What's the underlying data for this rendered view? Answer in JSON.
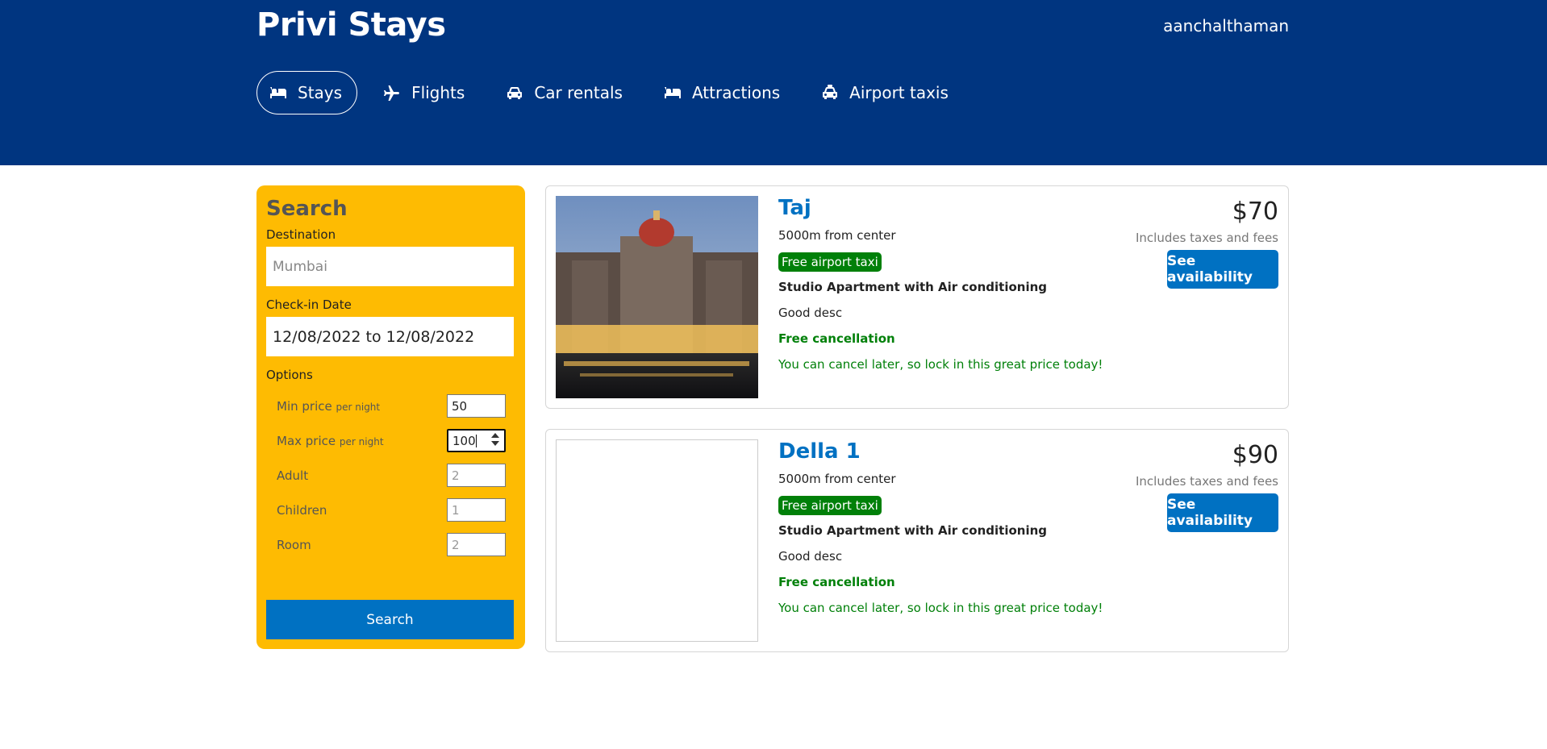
{
  "header": {
    "logo": "Privi Stays",
    "username": "aanchalthaman"
  },
  "nav": {
    "items": [
      {
        "label": "Stays",
        "icon": "bed-icon",
        "active": true
      },
      {
        "label": "Flights",
        "icon": "plane-icon",
        "active": false
      },
      {
        "label": "Car rentals",
        "icon": "car-icon",
        "active": false
      },
      {
        "label": "Attractions",
        "icon": "bed-icon",
        "active": false
      },
      {
        "label": "Airport taxis",
        "icon": "taxi-icon",
        "active": false
      }
    ]
  },
  "search": {
    "title": "Search",
    "destination_label": "Destination",
    "destination_placeholder": "Mumbai",
    "checkin_label": "Check-in Date",
    "checkin_value": "12/08/2022 to 12/08/2022",
    "options_label": "Options",
    "options": [
      {
        "label": "Min price",
        "suffix": "per night",
        "value": "50",
        "placeholder": ""
      },
      {
        "label": "Max price",
        "suffix": "per night",
        "value": "100",
        "placeholder": ""
      },
      {
        "label": "Adult",
        "suffix": "",
        "value": "",
        "placeholder": "2"
      },
      {
        "label": "Children",
        "suffix": "",
        "value": "",
        "placeholder": "1"
      },
      {
        "label": "Room",
        "suffix": "",
        "value": "",
        "placeholder": "2"
      }
    ],
    "button_label": "Search"
  },
  "results": [
    {
      "title": "Taj",
      "distance": "5000m from center",
      "badge": "Free airport taxi",
      "subtitle": "Studio Apartment with Air conditioning",
      "description": "Good desc",
      "cancel": "Free cancellation",
      "cancel_sub": "You can cancel later, so lock in this great price today!",
      "price": "$70",
      "tax": "Includes taxes and fees",
      "button": "See availability",
      "has_image": true
    },
    {
      "title": "Della 1",
      "distance": "5000m from center",
      "badge": "Free airport taxi",
      "subtitle": "Studio Apartment with Air conditioning",
      "description": "Good desc",
      "cancel": "Free cancellation",
      "cancel_sub": "You can cancel later, so lock in this great price today!",
      "price": "$90",
      "tax": "Includes taxes and fees",
      "button": "See availability",
      "has_image": false
    }
  ],
  "colors": {
    "header_bg": "#003580",
    "accent_blue": "#0071c2",
    "search_panel": "#febb02",
    "green": "#008009"
  }
}
